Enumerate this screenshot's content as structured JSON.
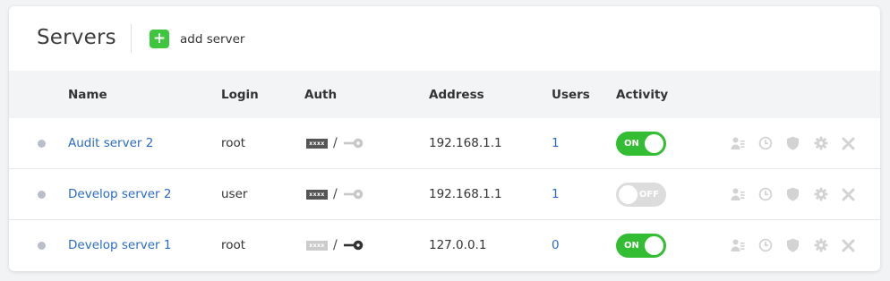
{
  "header": {
    "title": "Servers",
    "add_label": "add server",
    "add_symbol": "+"
  },
  "columns": {
    "name": "Name",
    "login": "Login",
    "auth": "Auth",
    "address": "Address",
    "users": "Users",
    "activity": "Activity"
  },
  "rows": [
    {
      "name": "Audit server 2",
      "login": "root",
      "password_text": "xxxx",
      "password_active": true,
      "key_active": false,
      "auth_separator": "/",
      "address": "192.168.1.1",
      "users": "1",
      "activity": "ON"
    },
    {
      "name": "Develop server 2",
      "login": "user",
      "password_text": "xxxx",
      "password_active": true,
      "key_active": false,
      "auth_separator": "/",
      "address": "192.168.1.1",
      "users": "1",
      "activity": "OFF"
    },
    {
      "name": "Develop server 1",
      "login": "root",
      "password_text": "xxxx",
      "password_active": false,
      "key_active": true,
      "auth_separator": "/",
      "address": "127.0.0.1",
      "users": "0",
      "activity": "ON"
    }
  ],
  "actions": [
    "user-list-icon",
    "clock-icon",
    "shield-icon",
    "gear-icon",
    "close-icon"
  ],
  "colors": {
    "accent_green": "#33bd33",
    "link_blue": "#2a6cc3",
    "icon_gray": "#d3d3d3",
    "status_dot": "#b9bfca"
  }
}
